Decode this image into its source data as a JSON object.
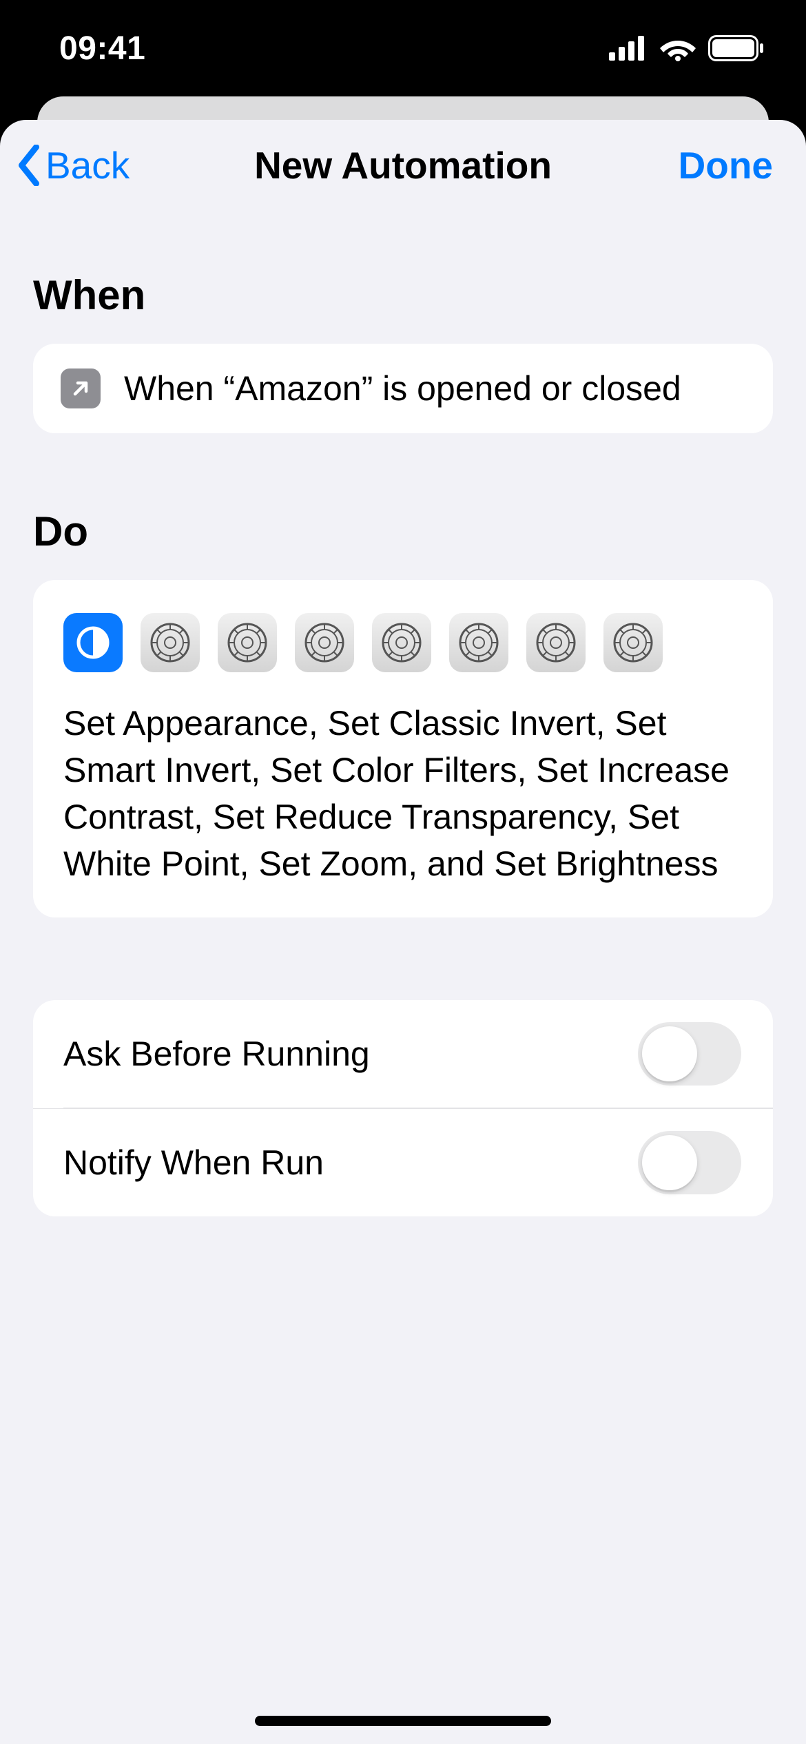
{
  "status": {
    "time": "09:41"
  },
  "nav": {
    "back": "Back",
    "title": "New Automation",
    "done": "Done"
  },
  "sections": {
    "when": {
      "header": "When",
      "text": "When “Amazon” is opened or closed"
    },
    "do": {
      "header": "Do",
      "summary": "Set Appearance, Set Classic Invert, Set Smart Invert, Set Color Filters, Set Increase Contrast, Set Reduce Transparency, Set White Point, Set Zoom, and Set Brightness",
      "icons": [
        "appearance",
        "settings",
        "settings",
        "settings",
        "settings",
        "settings",
        "settings",
        "settings"
      ]
    }
  },
  "options": {
    "ask_before_running": {
      "label": "Ask Before Running",
      "value": false
    },
    "notify_when_run": {
      "label": "Notify When Run",
      "value": false
    }
  }
}
